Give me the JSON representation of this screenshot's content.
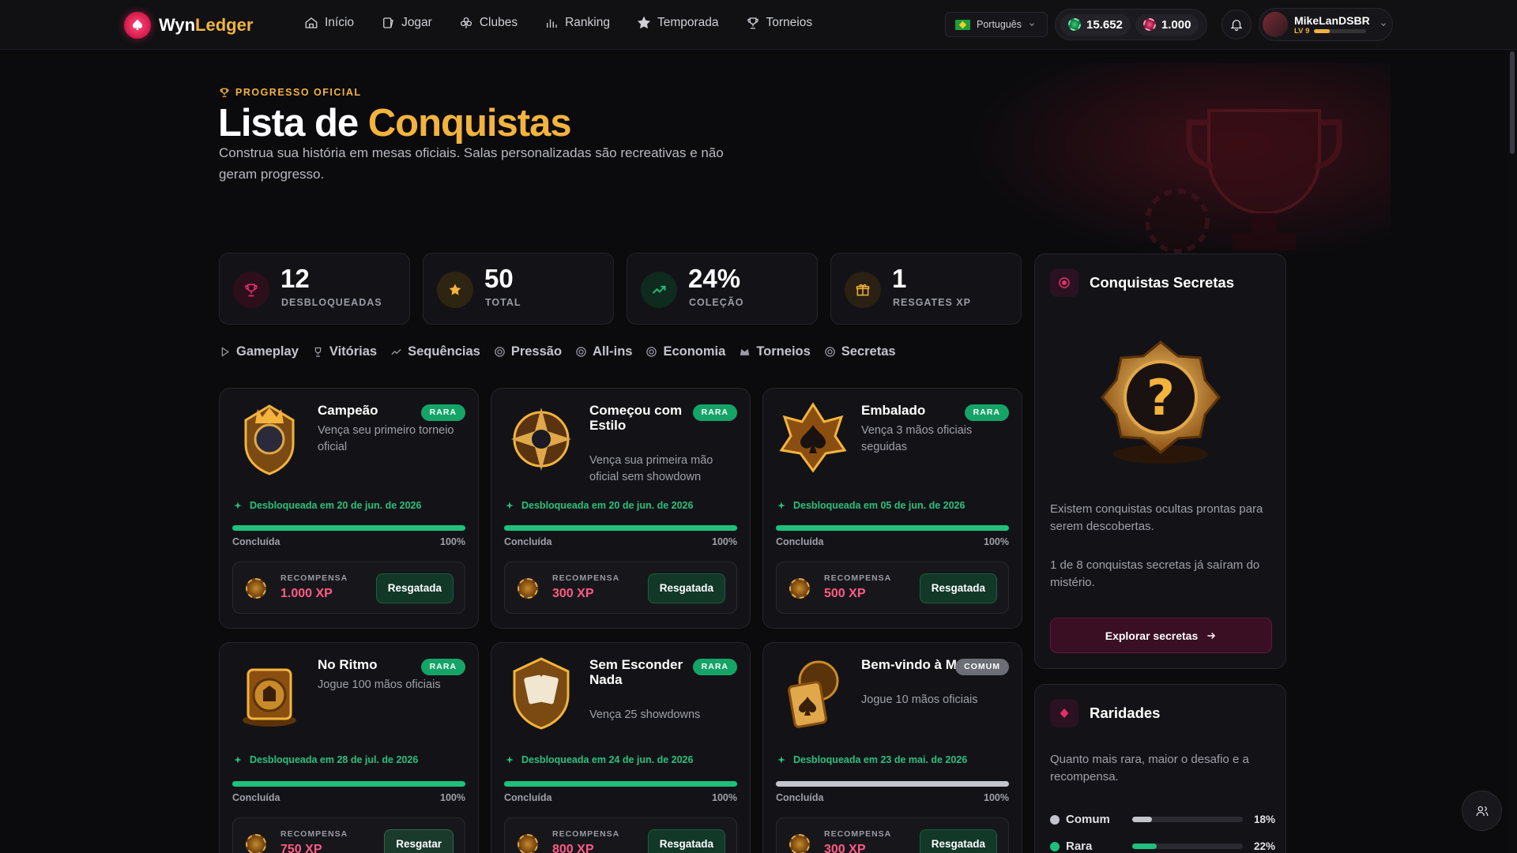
{
  "brand": {
    "name_a": "Wyn",
    "name_b": "Ledger"
  },
  "nav": [
    {
      "label": "Início",
      "icon": "home-icon"
    },
    {
      "label": "Jogar",
      "icon": "cards-icon"
    },
    {
      "label": "Clubes",
      "icon": "club-icon"
    },
    {
      "label": "Ranking",
      "icon": "bar-chart-icon"
    },
    {
      "label": "Temporada",
      "icon": "star-icon"
    },
    {
      "label": "Torneios",
      "icon": "trophy-icon"
    }
  ],
  "language": "Português",
  "balances": {
    "chips": "15.652",
    "gems": "1.000"
  },
  "user": {
    "name": "MikeLanDSBR",
    "level": "LV 9",
    "level_progress": 0.3
  },
  "hero": {
    "kicker": "PROGRESSO OFICIAL",
    "title_a": "Lista de ",
    "title_b": "Conquistas",
    "subtitle": "Construa sua história em mesas oficiais. Salas personalizadas são recreativas e não geram progresso."
  },
  "stats": [
    {
      "value": "12",
      "label": "DESBLOQUEADAS",
      "icon": "trophy-icon",
      "color": "#e0306a"
    },
    {
      "value": "50",
      "label": "TOTAL",
      "icon": "star-icon",
      "color": "#f3b33d"
    },
    {
      "value": "24%",
      "label": "COLEÇÃO",
      "icon": "trend-up-icon",
      "color": "#1fc07d"
    },
    {
      "value": "1",
      "label": "RESGATES XP",
      "icon": "gift-icon",
      "color": "#f3b33d"
    }
  ],
  "tabs": [
    "Gameplay",
    "Vitórias",
    "Sequências",
    "Pressão",
    "All-ins",
    "Economia",
    "Torneios",
    "Secretas"
  ],
  "achievements": [
    {
      "title": "Campeão",
      "rarity": "RARA",
      "desc": "Vença seu primeiro torneio oficial",
      "unlocked": "Desbloqueada em 20 de jun. de 2026",
      "status": "Concluída",
      "pct": "100%",
      "progress": 1.0,
      "reward_label": "RECOMPENSA",
      "reward": "1.000 XP",
      "button": "Resgatada"
    },
    {
      "title": "Começou com Estilo",
      "rarity": "RARA",
      "desc": "Vença sua primeira mão oficial sem showdown",
      "unlocked": "Desbloqueada em 20 de jun. de 2026",
      "status": "Concluída",
      "pct": "100%",
      "progress": 1.0,
      "reward_label": "RECOMPENSA",
      "reward": "300 XP",
      "button": "Resgatada"
    },
    {
      "title": "Embalado",
      "rarity": "RARA",
      "desc": "Vença 3 mãos oficiais seguidas",
      "unlocked": "Desbloqueada em 05 de jun. de 2026",
      "status": "Concluída",
      "pct": "100%",
      "progress": 1.0,
      "reward_label": "RECOMPENSA",
      "reward": "500 XP",
      "button": "Resgatada"
    },
    {
      "title": "No Ritmo",
      "rarity": "RARA",
      "desc": "Jogue 100 mãos oficiais",
      "unlocked": "Desbloqueada em 28 de jul. de 2026",
      "status": "Concluída",
      "pct": "100%",
      "progress": 1.0,
      "reward_label": "RECOMPENSA",
      "reward": "750 XP",
      "button": "Resgatar"
    },
    {
      "title": "Sem Esconder Nada",
      "rarity": "RARA",
      "desc": "Vença 25 showdowns",
      "unlocked": "Desbloqueada em 24 de jun. de 2026",
      "status": "Concluída",
      "pct": "100%",
      "progress": 1.0,
      "reward_label": "RECOMPENSA",
      "reward": "800 XP",
      "button": "Resgatada"
    },
    {
      "title": "Bem-vindo à Mesa",
      "rarity": "COMUM",
      "desc": "Jogue 10 mãos oficiais",
      "unlocked": "Desbloqueada em 23 de mai. de 2026",
      "status": "Concluída",
      "pct": "100%",
      "progress": 1.0,
      "reward_label": "RECOMPENSA",
      "reward": "300 XP",
      "button": "Resgatada"
    }
  ],
  "secrets": {
    "title": "Conquistas Secretas",
    "text1": "Existem conquistas ocultas prontas para serem descobertas.",
    "text2": "1 de 8 conquistas secretas já saíram do mistério.",
    "button": "Explorar secretas"
  },
  "rarities": {
    "title": "Raridades",
    "text": "Quanto mais rara, maior o desafio e a recompensa.",
    "rows": [
      {
        "name": "Comum",
        "pct": "18%",
        "value": 0.18,
        "color": "#c4c5cc"
      },
      {
        "name": "Rara",
        "pct": "22%",
        "value": 0.22,
        "color": "#1fc07d"
      }
    ]
  },
  "colors": {
    "accent_gold": "#f3b33d",
    "accent_pink": "#e0306a",
    "success": "#1fc07d",
    "background": "#0b0b0e"
  }
}
